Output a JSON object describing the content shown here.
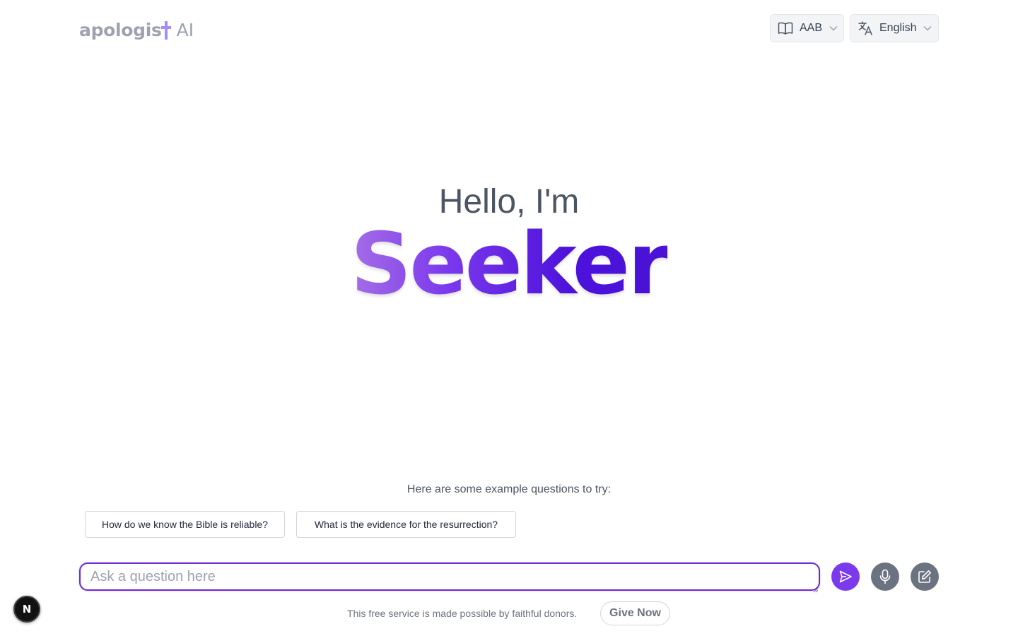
{
  "header": {
    "logo": {
      "word": "apologis",
      "suffix": "AI"
    },
    "version_selector": {
      "label": "AAB",
      "icon": "book-open-icon"
    },
    "language_selector": {
      "label": "English",
      "icon": "translate-icon"
    }
  },
  "hero": {
    "greeting": "Hello, I'm",
    "name": "Seeker"
  },
  "examples": {
    "title": "Here are some example questions to try:",
    "items": [
      "How do we know the Bible is reliable?",
      "What is the evidence for the resurrection?"
    ]
  },
  "composer": {
    "placeholder": "Ask a question here",
    "value": "",
    "send_icon": "send-icon",
    "mic_icon": "microphone-icon",
    "edit_icon": "edit-icon"
  },
  "footer": {
    "note": "This free service is made possible by faithful donors.",
    "give_label": "Give Now"
  },
  "dev_badge": {
    "letter": "N"
  },
  "colors": {
    "accent": "#7c3aed",
    "accent_dark": "#4a12d6",
    "muted_button": "#6b7280",
    "logo_cross": "#a78bfa"
  }
}
